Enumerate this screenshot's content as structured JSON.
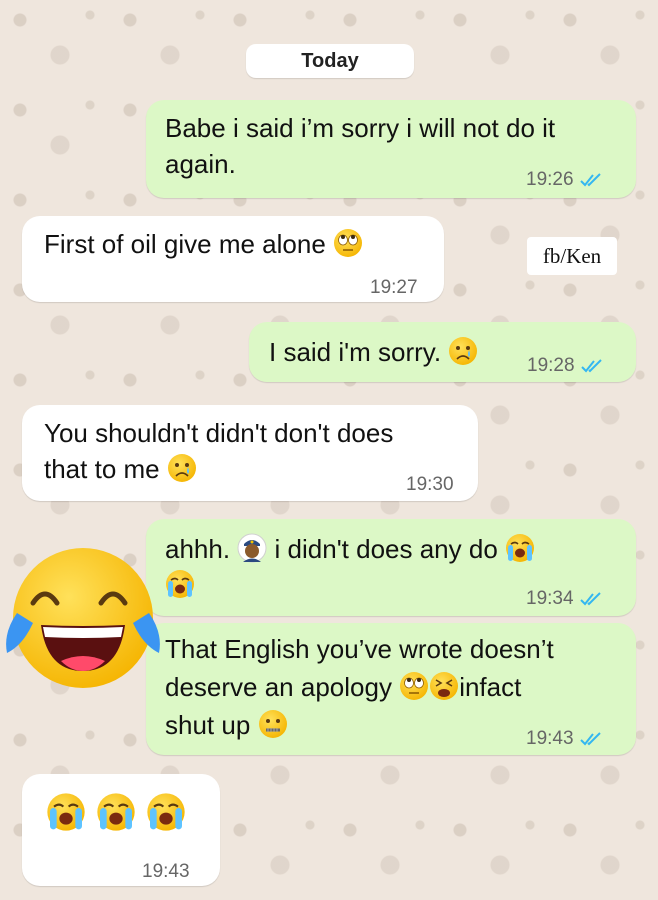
{
  "date_separator": "Today",
  "watermark": "fb/Ken",
  "messages": [
    {
      "direction": "outgoing",
      "lines": [
        "Babe i said i’m sorry i will not  do it",
        "again."
      ],
      "time": "19:26",
      "status": "read"
    },
    {
      "direction": "incoming",
      "lines": [
        "First of oil give me alone"
      ],
      "emoji": [
        "eye-roll-emoji"
      ],
      "time": "19:27"
    },
    {
      "direction": "outgoing",
      "lines": [
        "I said i'm sorry."
      ],
      "emoji": [
        "sad-tear-emoji"
      ],
      "time": "19:28",
      "status": "read"
    },
    {
      "direction": "incoming",
      "lines": [
        "You shouldn't didn't don't does",
        "that to me"
      ],
      "emoji": [
        "sad-tear-emoji"
      ],
      "time": "19:30"
    },
    {
      "direction": "outgoing",
      "lines": [
        "ahhh.",
        "i didn't does any do"
      ],
      "emoji": [
        "police-officer-emoji",
        "loudly-crying-emoji",
        "loudly-crying-emoji"
      ],
      "time": "19:34",
      "status": "read"
    },
    {
      "direction": "outgoing",
      "lines": [
        "That English you’ve wrote doesn’t",
        "deserve an apology",
        "infact",
        "shut up"
      ],
      "emoji": [
        "eye-roll-emoji",
        "tired-face-emoji",
        "zipper-mouth-emoji"
      ],
      "time": "19:43",
      "status": "read"
    },
    {
      "direction": "incoming",
      "lines": [],
      "emoji": [
        "loudly-crying-emoji",
        "loudly-crying-emoji",
        "loudly-crying-emoji"
      ],
      "time": "19:43"
    }
  ],
  "colors": {
    "outgoing_bubble": "#dcf8c6",
    "incoming_bubble": "#ffffff",
    "read_ticks": "#34b7f1",
    "background": "#efe6dd"
  }
}
